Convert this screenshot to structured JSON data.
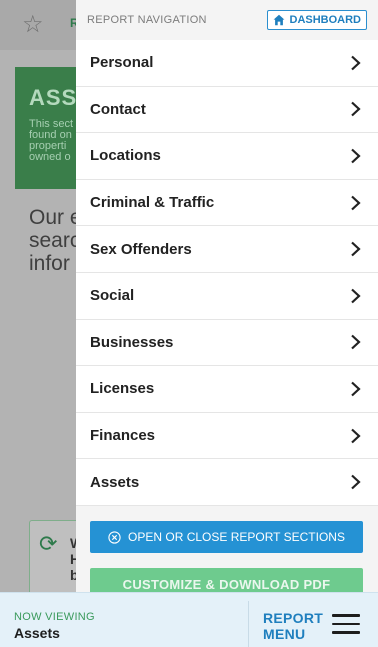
{
  "background": {
    "star_icon": "star-outline-icon",
    "topbar_fragment": "R",
    "assets_title": "ASSE",
    "assets_desc": "This sect found on properti owned o",
    "big_text": "Our e searc infor",
    "card_text": "W H b",
    "refresh_icon": "refresh-icon"
  },
  "drawer": {
    "header_label": "REPORT NAVIGATION",
    "dashboard_label": "DASHBOARD",
    "dashboard_icon": "home-icon",
    "items": [
      {
        "label": "Personal"
      },
      {
        "label": "Contact"
      },
      {
        "label": "Locations"
      },
      {
        "label": "Criminal & Traffic"
      },
      {
        "label": "Sex Offenders"
      },
      {
        "label": "Social"
      },
      {
        "label": "Businesses"
      },
      {
        "label": "Licenses"
      },
      {
        "label": "Finances"
      },
      {
        "label": "Assets"
      }
    ],
    "sections_button": "OPEN OR CLOSE REPORT SECTIONS",
    "sections_icon": "close-circle-icon",
    "customize_button": "CUSTOMIZE & DOWNLOAD PDF"
  },
  "bottom_bar": {
    "now_viewing_label": "NOW VIEWING",
    "now_viewing_value": "Assets",
    "report_menu_line1": "REPORT",
    "report_menu_line2": "MENU",
    "menu_icon": "hamburger-icon"
  },
  "colors": {
    "accent_blue": "#2592d4",
    "brand_green": "#3a7e4a",
    "customize_green": "#6ecb8e"
  }
}
